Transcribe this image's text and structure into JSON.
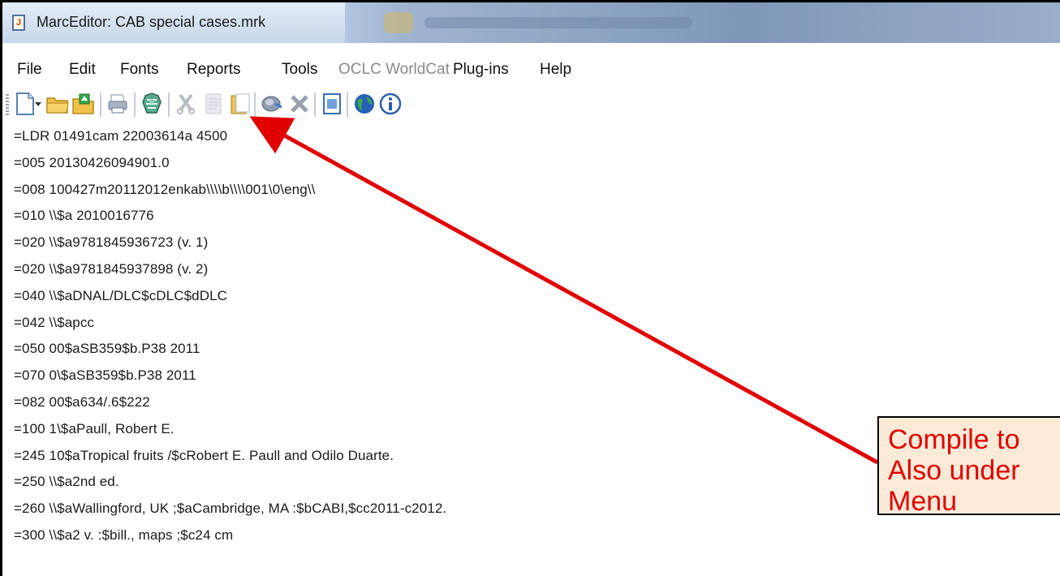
{
  "window": {
    "title": "MarcEditor: CAB special cases.mrk",
    "app_icon": "marcedit-document-icon"
  },
  "menu": [
    "File",
    "Edit",
    "Fonts",
    "Reports",
    "Tools",
    "OCLC WorldCat",
    "Plug-ins",
    "Help"
  ],
  "menu_disabled": [
    "OCLC WorldCat"
  ],
  "toolbar": [
    "new-document-icon",
    "dropdown-arrow-icon",
    "open-folder-icon",
    "open-recent-folder-icon",
    "print-icon",
    "compile-marc-icon",
    "cut-icon",
    "copy-icon",
    "paste-icon",
    "find-icon",
    "delete-icon",
    "preview-icon",
    "globe-icon",
    "info-icon"
  ],
  "record_lines": [
    "=LDR  01491cam  22003614a 4500",
    "=005  20130426094901.0",
    "=008  100427m20112012enkab\\\\\\\\b\\\\\\\\001\\0\\eng\\\\",
    "=010  \\\\$a  2010016776",
    "=020  \\\\$a9781845936723 (v. 1)",
    "=020  \\\\$a9781845937898 (v. 2)",
    "=040  \\\\$aDNAL/DLC$cDLC$dDLC",
    "=042  \\\\$apcc",
    "=050  00$aSB359$b.P38 2011",
    "=070  0\\$aSB359$b.P38 2011",
    "=082  00$a634/.6$222",
    "=100  1\\$aPaull, Robert E.",
    "=245  10$aTropical fruits /$cRobert E. Paull and Odilo Duarte.",
    "=250  \\\\$a2nd ed.",
    "=260  \\\\$aWallingford, UK ;$aCambridge, MA :$bCABI,$cc2011-c2012.",
    "=300  \\\\$a2 v. :$bill., maps ;$c24 cm"
  ],
  "callout": {
    "lines": [
      "Compile to",
      "Also under",
      "Menu"
    ],
    "text_color": "#e00000",
    "fill": "#fdebd8"
  },
  "arrow_color": "#e00000"
}
